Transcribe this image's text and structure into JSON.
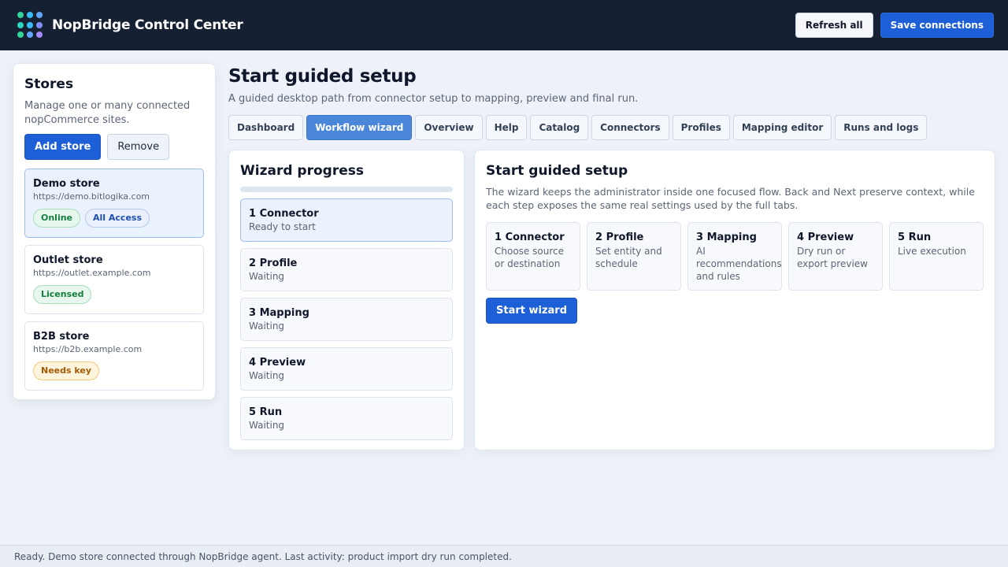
{
  "header": {
    "app_title": "NopBridge Control Center",
    "refresh_label": "Refresh all",
    "save_label": "Save connections",
    "logo_colors": [
      "#34d399",
      "#38bdf8",
      "#60a5fa",
      "#2dd4bf",
      "#38bdf8",
      "#818cf8",
      "#34d399",
      "#60a5fa",
      "#a78bfa"
    ]
  },
  "stores": {
    "title": "Stores",
    "description": "Manage one or many connected nopCommerce sites.",
    "add_label": "Add store",
    "remove_label": "Remove",
    "items": [
      {
        "name": "Demo store",
        "url": "https://demo.bitlogika.com",
        "badges": [
          {
            "label": "Online",
            "tone": "green"
          },
          {
            "label": "All Access",
            "tone": "blue"
          }
        ],
        "active": true
      },
      {
        "name": "Outlet store",
        "url": "https://outlet.example.com",
        "badges": [
          {
            "label": "Licensed",
            "tone": "green"
          }
        ],
        "active": false
      },
      {
        "name": "B2B store",
        "url": "https://b2b.example.com",
        "badges": [
          {
            "label": "Needs key",
            "tone": "amber"
          }
        ],
        "active": false
      }
    ]
  },
  "main": {
    "title": "Start guided setup",
    "subtitle": "A guided desktop path from connector setup to mapping, preview and final run.",
    "tabs": [
      {
        "label": "Dashboard",
        "active": false
      },
      {
        "label": "Workflow wizard",
        "active": true
      },
      {
        "label": "Overview",
        "active": false
      },
      {
        "label": "Help",
        "active": false
      },
      {
        "label": "Catalog",
        "active": false
      },
      {
        "label": "Connectors",
        "active": false
      },
      {
        "label": "Profiles",
        "active": false
      },
      {
        "label": "Mapping editor",
        "active": false
      },
      {
        "label": "Runs and logs",
        "active": false
      }
    ]
  },
  "wizard_progress": {
    "title": "Wizard progress",
    "progress_fraction": 0,
    "steps": [
      {
        "name": "1 Connector",
        "status": "Ready to start",
        "active": true
      },
      {
        "name": "2 Profile",
        "status": "Waiting",
        "active": false
      },
      {
        "name": "3 Mapping",
        "status": "Waiting",
        "active": false
      },
      {
        "name": "4 Preview",
        "status": "Waiting",
        "active": false
      },
      {
        "name": "5 Run",
        "status": "Waiting",
        "active": false
      }
    ]
  },
  "guided_setup": {
    "title": "Start guided setup",
    "description": "The wizard keeps the administrator inside one focused flow. Back and Next preserve context, while each step exposes the same real settings used by the full tabs.",
    "cards": [
      {
        "title": "1 Connector",
        "desc": "Choose source or destination"
      },
      {
        "title": "2 Profile",
        "desc": "Set entity and schedule"
      },
      {
        "title": "3 Mapping",
        "desc": "AI recommendations and rules"
      },
      {
        "title": "4 Preview",
        "desc": "Dry run or export preview"
      },
      {
        "title": "5 Run",
        "desc": "Live execution"
      }
    ],
    "start_label": "Start wizard"
  },
  "status_bar": {
    "text": "Ready. Demo store connected through NopBridge agent. Last activity: product import dry run completed."
  }
}
